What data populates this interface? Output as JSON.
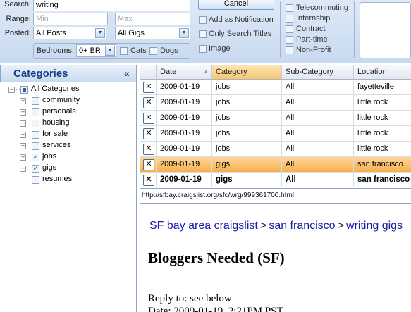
{
  "search": {
    "search_label": "Search:",
    "search_value": "writing",
    "range_label": "Range:",
    "min_placeholder": "Min",
    "max_placeholder": "Max",
    "posted_label": "Posted:",
    "posted_value": "All Posts",
    "gigs_value": "All Gigs",
    "bedrooms_label": "Bedrooms:",
    "bedrooms_value": "0+ BR",
    "cats_label": "Cats",
    "dogs_label": "Dogs",
    "cancel_label": "Cancel",
    "add_notification_label": "Add as Notification",
    "only_titles_label": "Only Search Titles",
    "image_label": "Image",
    "gig_types": [
      "Telecommuting",
      "Internship",
      "Contract",
      "Part-time",
      "Non-Profit"
    ]
  },
  "categories": {
    "title": "Categories",
    "collapse_glyph": "«",
    "root": {
      "label": "All Categories",
      "state": "partial"
    },
    "items": [
      {
        "label": "community",
        "checked": false,
        "expandable": true
      },
      {
        "label": "personals",
        "checked": false,
        "expandable": true
      },
      {
        "label": "housing",
        "checked": false,
        "expandable": true
      },
      {
        "label": "for sale",
        "checked": false,
        "expandable": true
      },
      {
        "label": "services",
        "checked": false,
        "expandable": true
      },
      {
        "label": "jobs",
        "checked": true,
        "expandable": true
      },
      {
        "label": "gigs",
        "checked": true,
        "expandable": true
      },
      {
        "label": "resumes",
        "checked": false,
        "expandable": false
      }
    ]
  },
  "grid": {
    "columns": [
      "Date",
      "Category",
      "Sub-Category",
      "Location"
    ],
    "delete_glyph": "✕",
    "rows": [
      {
        "date": "2009-01-19",
        "category": "jobs",
        "subcategory": "All",
        "location": "fayetteville",
        "state": "normal"
      },
      {
        "date": "2009-01-19",
        "category": "jobs",
        "subcategory": "All",
        "location": "little rock",
        "state": "normal"
      },
      {
        "date": "2009-01-19",
        "category": "jobs",
        "subcategory": "All",
        "location": "little rock",
        "state": "normal"
      },
      {
        "date": "2009-01-19",
        "category": "jobs",
        "subcategory": "All",
        "location": "little rock",
        "state": "normal"
      },
      {
        "date": "2009-01-19",
        "category": "jobs",
        "subcategory": "All",
        "location": "little rock",
        "state": "normal"
      },
      {
        "date": "2009-01-19",
        "category": "gigs",
        "subcategory": "All",
        "location": "san francisco",
        "state": "selected"
      },
      {
        "date": "2009-01-19",
        "category": "gigs",
        "subcategory": "All",
        "location": "san francisco",
        "state": "unread"
      }
    ]
  },
  "browser": {
    "url": "http://sfbay.craigslist.org/sfc/wrg/999361700.html",
    "breadcrumb": [
      "SF bay area craigslist",
      "san francisco",
      "writing gigs"
    ],
    "breadcrumb_sep": ">",
    "post_title": "Bloggers Needed (SF)",
    "reply_to": "Reply to: see below",
    "date_line": "Date: 2009-01-19, 2:21PM PST"
  },
  "colors": {
    "panel_bg": "#c8daf0",
    "header_text": "#15428b",
    "sorted_header": "#f8c772",
    "selected_row": "#f6b04e",
    "link": "#1a1aa6"
  }
}
